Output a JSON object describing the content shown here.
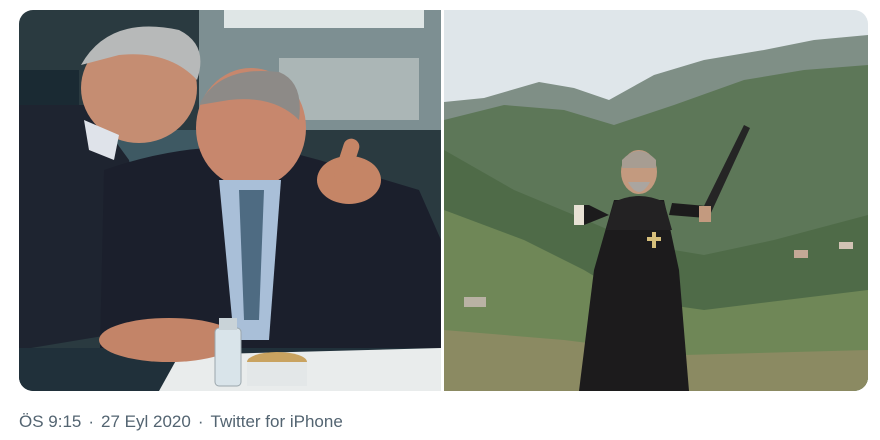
{
  "tweet": {
    "time": "ÖS 9:15",
    "separator": "·",
    "date": "27 Eyl 2020",
    "source": "Twitter for iPhone"
  },
  "media": {
    "left_photo": "photo",
    "right_photo": "photo"
  },
  "colors": {
    "meta_text": "#536471",
    "sky": "#dfe6ea",
    "mountain": "#4f6b48"
  }
}
